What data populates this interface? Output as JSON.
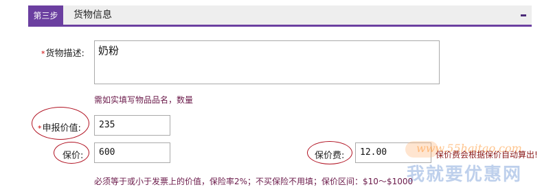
{
  "header": {
    "step_label": "第三步",
    "title": "货物信息",
    "collapse_symbol": "−"
  },
  "form": {
    "description": {
      "label": "货物描述:",
      "value": "奶粉",
      "hint": "需如实填写物品品名，数量"
    },
    "declared_value": {
      "label": "申报价值:",
      "value": "235"
    },
    "insured_value": {
      "label": "保价:",
      "value": "600"
    },
    "insurance_fee": {
      "label": "保价费:",
      "value": "12.00",
      "note": "保价费会根据保价自动算出!"
    },
    "insurance_rule": "必须等于或小于发票上的价值，保险率2%；不买保险不用填；保价区间：$10～$1000"
  },
  "watermark": {
    "url": "www.55haitao.com",
    "slogan": "我就要优惠网"
  },
  "colors": {
    "accent": "#6b3fa0",
    "hint": "#6b1a4a",
    "annotation": "#b01020"
  }
}
